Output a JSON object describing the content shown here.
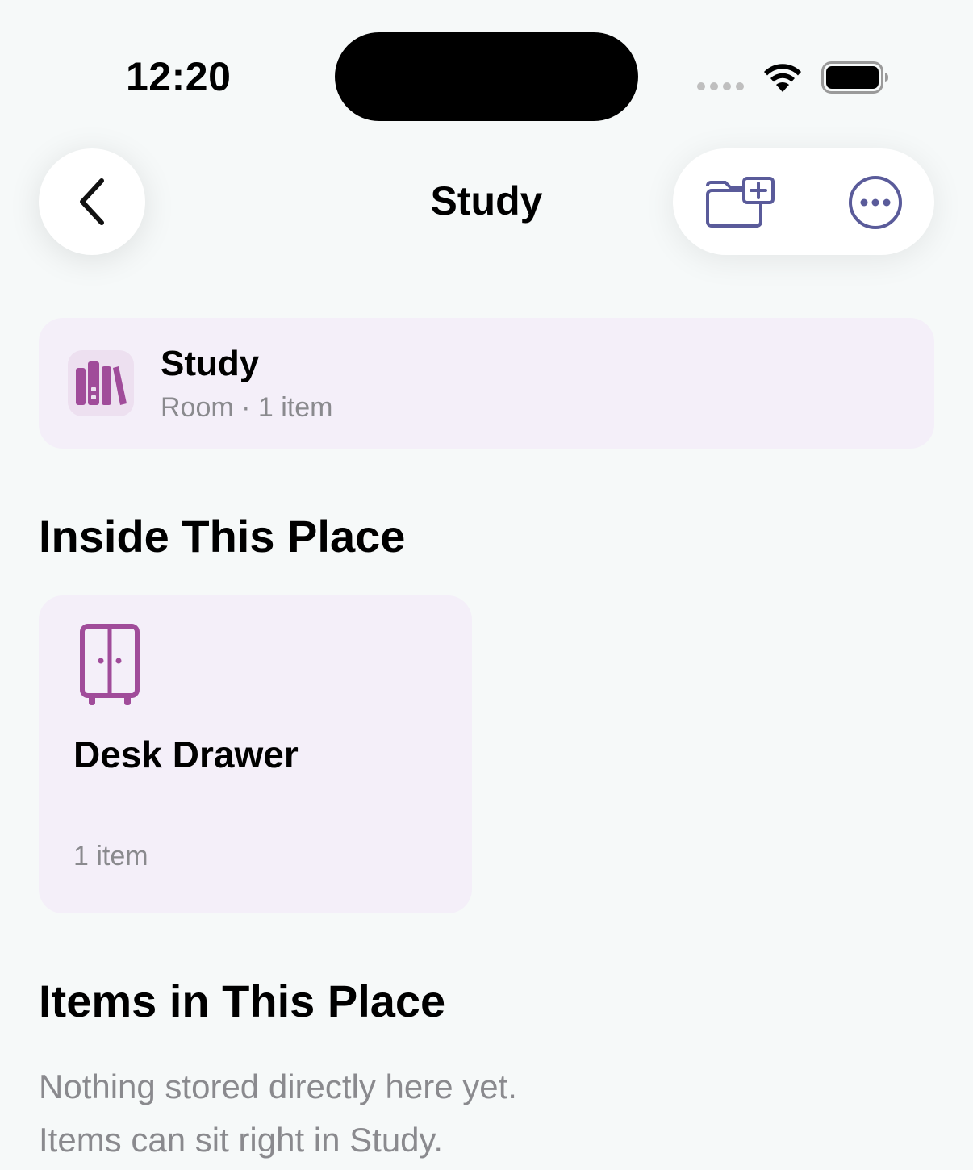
{
  "status_bar": {
    "time": "12:20"
  },
  "nav": {
    "title": "Study"
  },
  "place": {
    "name": "Study",
    "meta": "Room · 1 item",
    "accent": "#a04c9a"
  },
  "sections": {
    "inside_title": "Inside This Place",
    "items_title": "Items in This Place"
  },
  "containers": [
    {
      "name": "Desk Drawer",
      "count": "1 item",
      "icon": "cabinet-icon"
    }
  ],
  "empty_state": {
    "line1": "Nothing stored directly here yet.",
    "line2": "Items can sit right in Study."
  },
  "colors": {
    "background": "#f6f9f9",
    "card": "#f4eff9",
    "toolbar_icon": "#5a5b9a",
    "secondary_text": "#8a8a8e"
  }
}
